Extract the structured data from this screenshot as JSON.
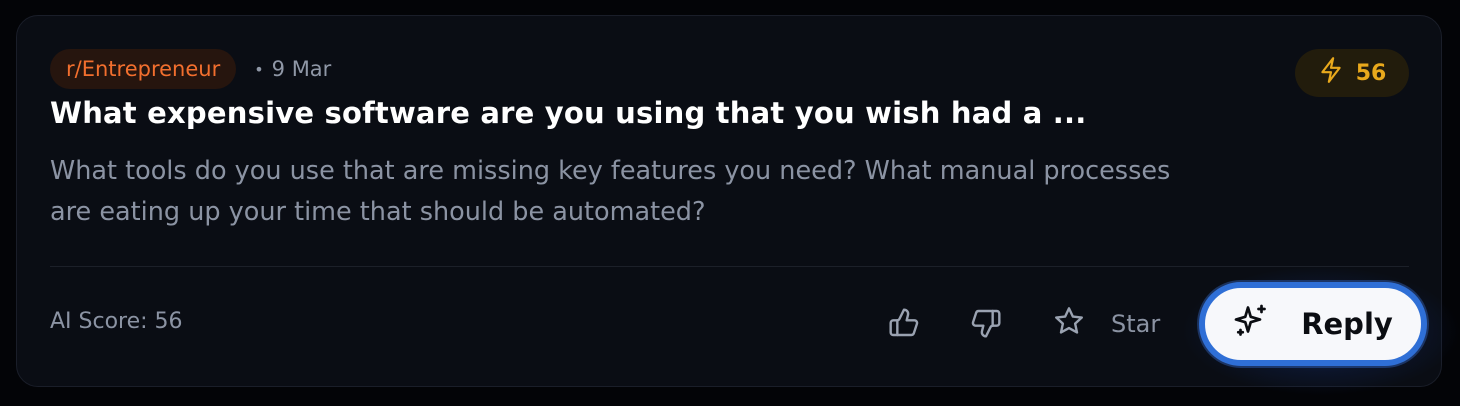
{
  "post": {
    "subreddit": "r/Entrepreneur",
    "date_separator": "•",
    "date": "9 Mar",
    "score": "56",
    "title": "What expensive software are you using that you wish had a ...",
    "body": "What tools do you use that are missing key features you need? What manual processes are eating up your time that should be automated?"
  },
  "footer": {
    "ai_score_label": "AI Score: 56",
    "star_label": "Star",
    "reply_label": "Reply"
  },
  "colors": {
    "card_bg": "#0a0d14",
    "subreddit_text": "#f26f2e",
    "score_accent": "#e9a91c",
    "reply_border": "#2f6fd6"
  },
  "icons": {
    "score": "lightning-icon",
    "upvote": "thumbs-up-icon",
    "downvote": "thumbs-down-icon",
    "star": "star-icon",
    "reply": "sparkles-icon"
  }
}
